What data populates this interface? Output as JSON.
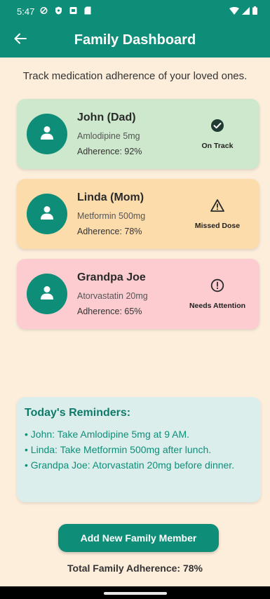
{
  "status_bar": {
    "time": "5:47",
    "icons": [
      "location-icon",
      "shield-icon",
      "app-icon",
      "sd-card-icon"
    ],
    "right_icons": [
      "wifi-icon",
      "cell-signal-icon",
      "battery-icon"
    ]
  },
  "app_bar": {
    "title": "Family Dashboard",
    "back_icon": "arrow-left-icon"
  },
  "subtitle": "Track medication adherence of your loved ones.",
  "members": [
    {
      "name": "John (Dad)",
      "medication": "Amlodipine 5mg",
      "adherence": "Adherence: 92%",
      "status": "On Track",
      "status_icon": "check-circle-icon",
      "card_color": "#CDE8CC"
    },
    {
      "name": "Linda (Mom)",
      "medication": "Metformin 500mg",
      "adherence": "Adherence: 78%",
      "status": "Missed Dose",
      "status_icon": "warning-triangle-icon",
      "card_color": "#FDDCAC"
    },
    {
      "name": "Grandpa Joe",
      "medication": "Atorvastatin 20mg",
      "adherence": "Adherence: 65%",
      "status": "Needs Attention",
      "status_icon": "alert-circle-icon",
      "card_color": "#FCCCD0"
    }
  ],
  "reminders": {
    "title": "Today's Reminders:",
    "items": [
      "• John: Take Amlodipine 5mg at 9 AM.",
      "• Linda: Take Metformin 500mg after lunch.",
      "• Grandpa Joe: Atorvastatin 20mg before dinner."
    ]
  },
  "add_button": "Add New Family Member",
  "total_adherence": "Total Family Adherence: 78%",
  "colors": {
    "primary": "#0E8E79",
    "background": "#FDEEDC",
    "reminder_bg": "#DCEEEC"
  }
}
